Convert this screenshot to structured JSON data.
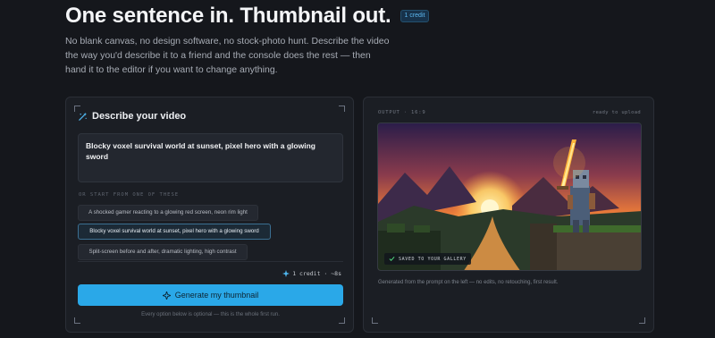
{
  "hero": {
    "title": "One sentence in. Thumbnail out.",
    "badge": "1 credit",
    "description": "No blank canvas, no design software, no stock-photo hunt. Describe the video the way you'd describe it to a friend and the console does the rest — then hand it to the editor if you want to change anything."
  },
  "form": {
    "title": "Describe your video",
    "prompt_value": "Blocky voxel survival world at sunset, pixel hero with a glowing sword",
    "suggestions_label": "OR START FROM ONE OF THESE",
    "suggestions": [
      "A shocked gamer reacting to a glowing red screen, neon rim light",
      "Blocky voxel survival world at sunset, pixel hero with a glowing sword",
      "Split-screen before and after, dramatic lighting, high contrast"
    ],
    "active_suggestion": 1,
    "cost": "1 credit · ~8s",
    "generate_label": "Generate my thumbnail",
    "footnote": "Every option below is optional — this is the whole first run."
  },
  "output": {
    "label": "OUTPUT · 16:9",
    "status": "ready to upload",
    "saved_tag": "SAVED TO YOUR GALLERY",
    "caption": "Generated from the prompt on the left — no edits, no retouching, first result."
  },
  "colors": {
    "background": "#15171c",
    "panel": "#1b1e24",
    "accent": "#2aa8e8",
    "badge": "#5db8f0"
  },
  "icons": {
    "form_header": "magic-wand-icon",
    "cost": "sparkle-icon",
    "generate": "sparkle-icon",
    "saved": "check-icon"
  }
}
